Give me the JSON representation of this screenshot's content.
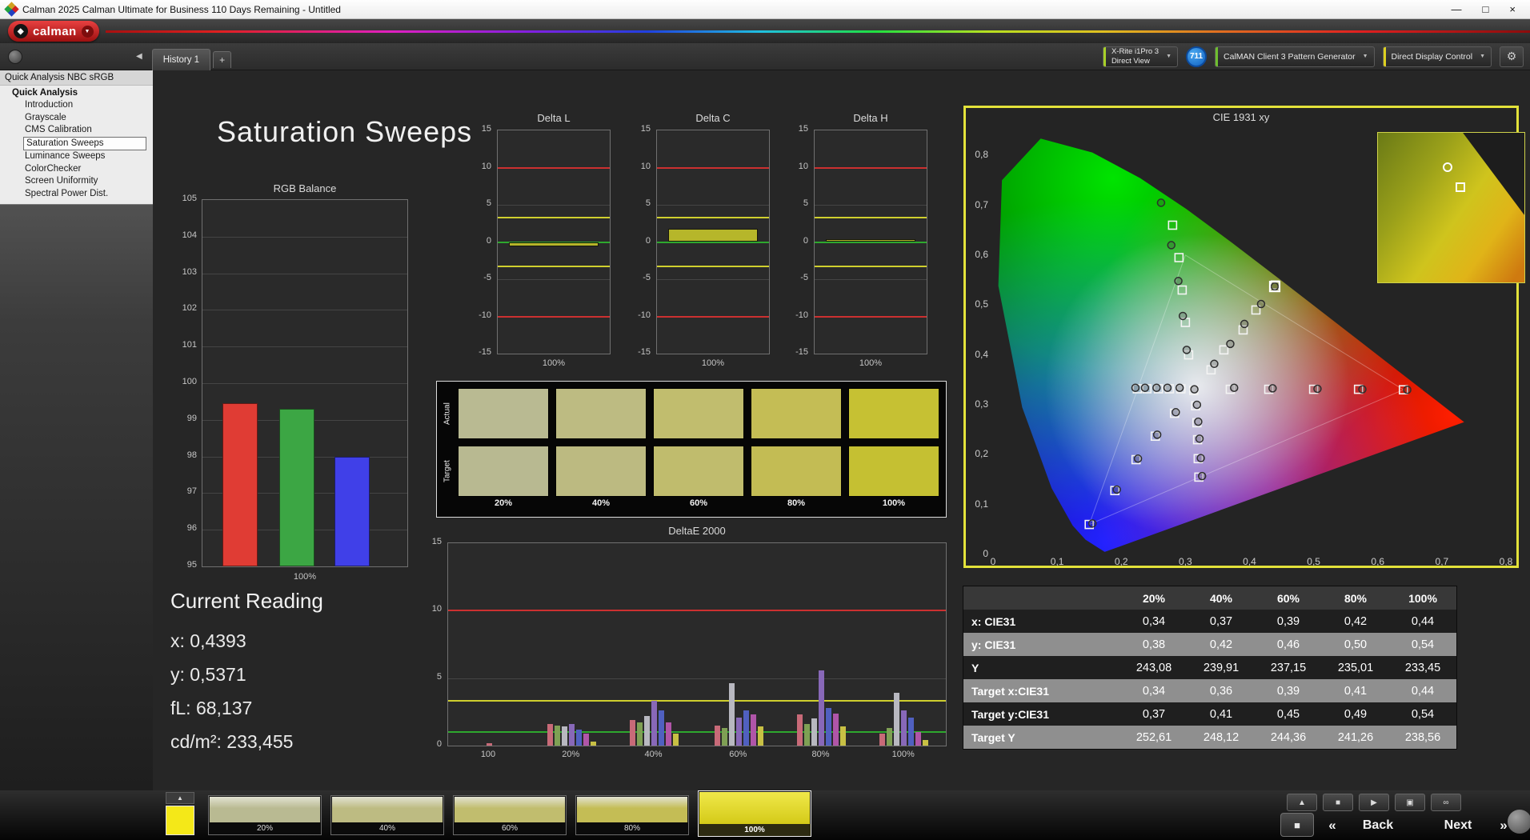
{
  "window": {
    "title": "Calman 2025 Calman Ultimate for Business 110 Days Remaining  - Untitled",
    "minimize": "—",
    "maximize": "□",
    "close": "×"
  },
  "brand": {
    "logo_text": "calman",
    "logo_mark": "◆",
    "logo_caret": "▼"
  },
  "toolbar": {
    "tab": "History 1",
    "add_tab": "+",
    "collapse_icon": "◀",
    "meter_line1": "X-Rite i1Pro 3",
    "meter_line2": "Direct View",
    "badge": "711",
    "pattern_generator": "CalMAN Client 3 Pattern Generator",
    "display_control": "Direct Display Control",
    "gear": "⚙",
    "caret": "▼"
  },
  "sidebar": {
    "header": "Quick Analysis NBC sRGB",
    "root": "Quick Analysis",
    "items": [
      "Introduction",
      "Grayscale",
      "CMS Calibration",
      "Saturation Sweeps",
      "Luminance Sweeps",
      "ColorChecker",
      "Screen Uniformity",
      "Spectral Power Dist."
    ],
    "selected": "Saturation Sweeps"
  },
  "page_title": "Saturation Sweeps",
  "current_reading": {
    "title": "Current Reading",
    "lines": [
      "x: 0,4393",
      "y: 0,5371",
      "fL: 68,137",
      "cd/m²: 233,455"
    ]
  },
  "patches": {
    "row_labels": [
      "Actual",
      "Target"
    ],
    "col_labels": [
      "20%",
      "40%",
      "60%",
      "80%",
      "100%"
    ],
    "actual_colors": [
      "#b9ba92",
      "#bdbb82",
      "#c1bd6e",
      "#c4bd55",
      "#c6c133"
    ],
    "target_colors": [
      "#b8b991",
      "#bcba81",
      "#c0bc6d",
      "#c3bc54",
      "#c5c032"
    ]
  },
  "chart_data": [
    {
      "type": "bar",
      "title": "RGB Balance",
      "xlabel": "100%",
      "categories": [
        "Red",
        "Green",
        "Blue"
      ],
      "values": [
        99.45,
        99.3,
        98.0
      ],
      "colors": [
        "#e03c34",
        "#3ca644",
        "#4040e8"
      ],
      "ylim": [
        95,
        105
      ]
    },
    {
      "type": "bar",
      "title": "Delta L",
      "xlabel": "100%",
      "values": [
        -0.6
      ],
      "ylim": [
        -15,
        15
      ],
      "ref_lines": [
        {
          "y": 10,
          "color": "#cc3030"
        },
        {
          "y": 3.3,
          "color": "#cfcf2e"
        },
        {
          "y": 0,
          "color": "#2ea82e"
        },
        {
          "y": -3.3,
          "color": "#cfcf2e"
        },
        {
          "y": -10,
          "color": "#cc3030"
        }
      ]
    },
    {
      "type": "bar",
      "title": "Delta C",
      "xlabel": "100%",
      "values": [
        1.8
      ],
      "ylim": [
        -15,
        15
      ],
      "ref_lines": [
        {
          "y": 10,
          "color": "#cc3030"
        },
        {
          "y": 3.3,
          "color": "#cfcf2e"
        },
        {
          "y": 0,
          "color": "#2ea82e"
        },
        {
          "y": -3.3,
          "color": "#cfcf2e"
        },
        {
          "y": -10,
          "color": "#cc3030"
        }
      ]
    },
    {
      "type": "bar",
      "title": "Delta H",
      "xlabel": "100%",
      "values": [
        0.4
      ],
      "ylim": [
        -15,
        15
      ],
      "ref_lines": [
        {
          "y": 10,
          "color": "#cc3030"
        },
        {
          "y": 3.3,
          "color": "#cfcf2e"
        },
        {
          "y": 0,
          "color": "#2ea82e"
        },
        {
          "y": -3.3,
          "color": "#cfcf2e"
        },
        {
          "y": -10,
          "color": "#cc3030"
        }
      ]
    },
    {
      "type": "bar",
      "title": "DeltaE 2000",
      "ylim": [
        0,
        15
      ],
      "categories": [
        "100",
        "20%",
        "40%",
        "60%",
        "80%",
        "100%"
      ],
      "series_colors": [
        "#c86a78",
        "#7fa054",
        "#b8b8c0",
        "#8868b8",
        "#5060c0",
        "#b055a8",
        "#c8c044"
      ],
      "groups": [
        [
          0.2
        ],
        [
          1.6,
          1.5,
          1.4,
          1.6,
          1.2,
          0.9,
          0.3
        ],
        [
          1.9,
          1.7,
          2.2,
          3.3,
          2.6,
          1.7,
          0.9
        ],
        [
          1.5,
          1.3,
          4.6,
          2.1,
          2.6,
          2.3,
          1.4
        ],
        [
          2.3,
          1.6,
          2.0,
          5.6,
          2.8,
          2.4,
          1.4
        ],
        [
          0.9,
          1.3,
          3.9,
          2.6,
          2.1,
          1.0,
          0.4
        ]
      ],
      "ref_lines": [
        {
          "y": 10,
          "color": "#cc3030"
        },
        {
          "y": 3.3,
          "color": "#cfcf2e"
        },
        {
          "y": 1,
          "color": "#2ea82e"
        }
      ]
    },
    {
      "type": "scatter",
      "title": "CIE 1931 xy",
      "xlim": [
        0,
        0.8
      ],
      "ylim": [
        0,
        0.85
      ],
      "xticks": [
        "0",
        "0,1",
        "0,2",
        "0,3",
        "0,4",
        "0,5",
        "0,6",
        "0,7",
        "0,8"
      ],
      "yticks": [
        "0",
        "0,1",
        "0,2",
        "0,3",
        "0,4",
        "0,5",
        "0,6",
        "0,7",
        "0,8"
      ],
      "current": [
        0.4393,
        0.5371
      ],
      "targets": [
        [
          0.34,
          0.37
        ],
        [
          0.36,
          0.41
        ],
        [
          0.39,
          0.45
        ],
        [
          0.41,
          0.49
        ],
        [
          0.44,
          0.54
        ],
        [
          0.37,
          0.331
        ],
        [
          0.43,
          0.331
        ],
        [
          0.5,
          0.331
        ],
        [
          0.57,
          0.331
        ],
        [
          0.64,
          0.33
        ],
        [
          0.305,
          0.4
        ],
        [
          0.3,
          0.465
        ],
        [
          0.295,
          0.53
        ],
        [
          0.29,
          0.595
        ],
        [
          0.28,
          0.66
        ],
        [
          0.283,
          0.283
        ],
        [
          0.253,
          0.237
        ],
        [
          0.223,
          0.19
        ],
        [
          0.19,
          0.128
        ],
        [
          0.15,
          0.06
        ],
        [
          0.293,
          0.332
        ],
        [
          0.275,
          0.332
        ],
        [
          0.258,
          0.332
        ],
        [
          0.24,
          0.332
        ],
        [
          0.225,
          0.332
        ],
        [
          0.316,
          0.298
        ],
        [
          0.318,
          0.264
        ],
        [
          0.319,
          0.23
        ],
        [
          0.32,
          0.192
        ],
        [
          0.321,
          0.155
        ],
        [
          0.313,
          0.329
        ]
      ],
      "measurements": [
        [
          0.345,
          0.382
        ],
        [
          0.37,
          0.422
        ],
        [
          0.392,
          0.462
        ],
        [
          0.418,
          0.502
        ],
        [
          0.4393,
          0.5371
        ],
        [
          0.376,
          0.334
        ],
        [
          0.436,
          0.333
        ],
        [
          0.506,
          0.332
        ],
        [
          0.576,
          0.331
        ],
        [
          0.646,
          0.33
        ],
        [
          0.302,
          0.41
        ],
        [
          0.296,
          0.478
        ],
        [
          0.289,
          0.548
        ],
        [
          0.278,
          0.62
        ],
        [
          0.262,
          0.705
        ],
        [
          0.285,
          0.285
        ],
        [
          0.256,
          0.24
        ],
        [
          0.226,
          0.192
        ],
        [
          0.193,
          0.13
        ],
        [
          0.155,
          0.062
        ],
        [
          0.291,
          0.334
        ],
        [
          0.272,
          0.334
        ],
        [
          0.255,
          0.334
        ],
        [
          0.237,
          0.334
        ],
        [
          0.222,
          0.334
        ],
        [
          0.318,
          0.3
        ],
        [
          0.32,
          0.266
        ],
        [
          0.322,
          0.232
        ],
        [
          0.324,
          0.193
        ],
        [
          0.326,
          0.157
        ],
        [
          0.314,
          0.331
        ]
      ]
    }
  ],
  "table": {
    "headers": [
      "",
      "20%",
      "40%",
      "60%",
      "80%",
      "100%"
    ],
    "rows": [
      {
        "label": "x: CIE31",
        "values": [
          "0,34",
          "0,37",
          "0,39",
          "0,42",
          "0,44"
        ]
      },
      {
        "label": "y: CIE31",
        "values": [
          "0,38",
          "0,42",
          "0,46",
          "0,50",
          "0,54"
        ]
      },
      {
        "label": "Y",
        "values": [
          "243,08",
          "239,91",
          "237,15",
          "235,01",
          "233,45"
        ]
      },
      {
        "label": "Target x:CIE31",
        "values": [
          "0,34",
          "0,36",
          "0,39",
          "0,41",
          "0,44"
        ]
      },
      {
        "label": "Target y:CIE31",
        "values": [
          "0,37",
          "0,41",
          "0,45",
          "0,49",
          "0,54"
        ]
      },
      {
        "label": "Target Y",
        "values": [
          "252,61",
          "248,12",
          "244,36",
          "241,26",
          "238,56"
        ]
      }
    ]
  },
  "bottom": {
    "up_icon": "▲",
    "patch_buttons": [
      {
        "label": "20%",
        "color": "#b9ba92"
      },
      {
        "label": "40%",
        "color": "#bdbb82"
      },
      {
        "label": "60%",
        "color": "#c1bd6e"
      },
      {
        "label": "80%",
        "color": "#c4bd55"
      },
      {
        "label": "100%",
        "color": "#d9d020",
        "active": true
      }
    ],
    "media_buttons": [
      {
        "name": "collapse-up-button",
        "glyph": "▲"
      },
      {
        "name": "stop-button",
        "glyph": "■"
      },
      {
        "name": "play-button",
        "glyph": "▶"
      },
      {
        "name": "pattern-window-button",
        "glyph": "▣"
      },
      {
        "name": "loop-button",
        "glyph": "∞"
      }
    ],
    "window_toggle": "■",
    "prev": "«",
    "back": "Back",
    "next": "Next",
    "forward": "»"
  }
}
